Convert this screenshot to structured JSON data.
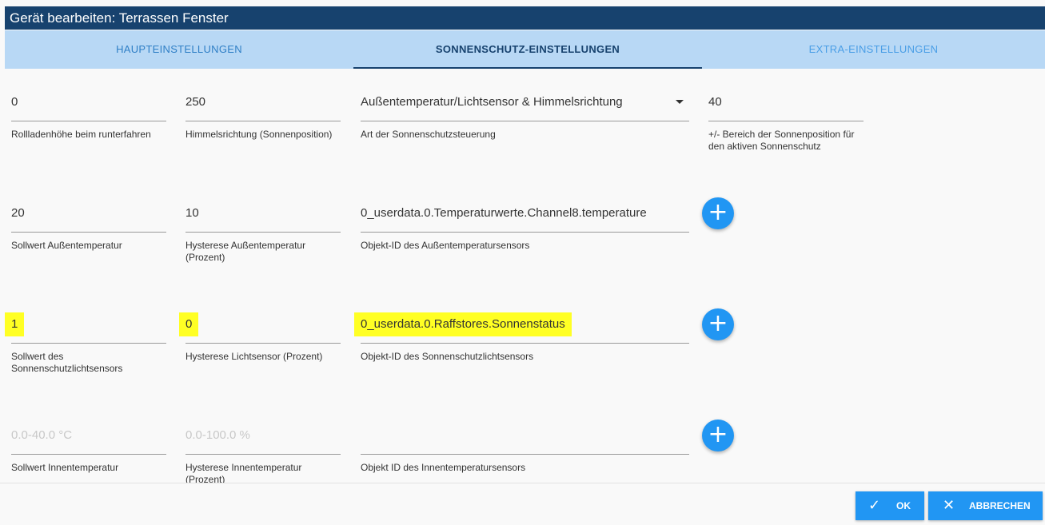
{
  "window": {
    "title": "Gerät bearbeiten: Terrassen Fenster"
  },
  "tabs": [
    {
      "label": "HAUPTEINSTELLUNGEN"
    },
    {
      "label": "SONNENSCHUTZ-EINSTELLUNGEN"
    },
    {
      "label": "EXTRA-EINSTELLUNGEN"
    }
  ],
  "row1": {
    "height": {
      "value": "0",
      "label": "Rollladenhöhe beim runterfahren"
    },
    "direction": {
      "value": "250",
      "label": "Himmelsrichtung (Sonnenposition)"
    },
    "mode": {
      "value": "Außentemperatur/Lichtsensor & Himmelsrichtung",
      "label": "Art der Sonnenschutzsteuerung"
    },
    "range": {
      "value": "40",
      "label": "+/- Bereich der Sonnenposition für den aktiven Sonnenschutz"
    }
  },
  "row2": {
    "setpoint": {
      "value": "20",
      "label": "Sollwert Außentemperatur"
    },
    "hysteresis": {
      "value": "10",
      "label": "Hysterese Außentemperatur (Prozent)"
    },
    "object": {
      "value": "0_userdata.0.Temperaturwerte.Channel8.temperature",
      "label": "Objekt-ID des Außentemperatursensors"
    }
  },
  "row3": {
    "setpoint": {
      "value": "1",
      "label": "Sollwert des Sonnenschutzlichtsensors"
    },
    "hysteresis": {
      "value": "0",
      "label": "Hysterese Lichtsensor (Prozent)"
    },
    "object": {
      "value": "0_userdata.0.Raffstores.Sonnenstatus",
      "label": "Objekt-ID des Sonnenschutzlichtsensors"
    }
  },
  "row4": {
    "setpoint": {
      "placeholder": "0.0-40.0 °C",
      "label": "Sollwert Innentemperatur"
    },
    "hysteresis": {
      "placeholder": "0.0-100.0 %",
      "label": "Hysterese Innentemperatur (Prozent)"
    },
    "object": {
      "value": "",
      "label": "Objekt ID des Innentemperatursensors"
    }
  },
  "fab": {
    "symbol": "+"
  },
  "footer": {
    "ok": {
      "label": "OK",
      "icon": "✓"
    },
    "cancel": {
      "label": "ABBRECHEN",
      "icon": "✕"
    }
  },
  "colors": {
    "title_bar": "#17426e",
    "tab_bar": "#b8d8f5",
    "accent": "#2196f3",
    "highlight": "#ffff24"
  }
}
